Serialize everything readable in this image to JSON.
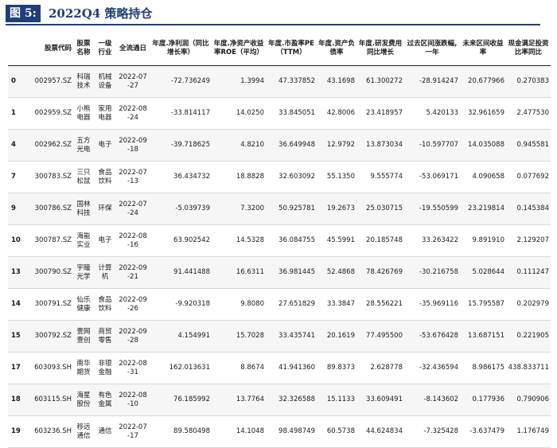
{
  "figure": {
    "label": "图 5:",
    "title": "2022Q4 策略持仓"
  },
  "table": {
    "headers": [
      "",
      "股票代码",
      "股票名称",
      "一级行业",
      "全流通日",
      "年度.净利润（同比增长率）",
      "年度.净资产收益率ROE（平均）",
      "年度.市盈率PE（TTM）",
      "年度.资产负债率",
      "年度.研发费用同比增长",
      "过去区间涨跌幅,一年",
      "未来区间收益率",
      "现金满足投资比率同比"
    ],
    "rows": [
      [
        "0",
        "002957.SZ",
        "科瑞技术",
        "机械设备",
        "2022-07-27",
        "-72.736249",
        "1.3994",
        "47.337852",
        "43.1698",
        "61.300272",
        "-28.914247",
        "20.677966",
        "0.270383"
      ],
      [
        "1",
        "002959.SZ",
        "小熊电器",
        "家用电器",
        "2022-08-24",
        "-33.814117",
        "14.0250",
        "33.845051",
        "42.8006",
        "23.418957",
        "5.420133",
        "32.961659",
        "2.477530"
      ],
      [
        "4",
        "002962.SZ",
        "五方光电",
        "电子",
        "2022-09-18",
        "-39.718625",
        "4.8210",
        "36.649948",
        "12.9792",
        "13.873034",
        "-10.597707",
        "14.035088",
        "0.945581"
      ],
      [
        "7",
        "300783.SZ",
        "三只松鼠",
        "食品饮料",
        "2022-07-13",
        "36.434732",
        "18.8828",
        "32.603092",
        "55.1350",
        "9.555774",
        "-53.069171",
        "4.090658",
        "0.077692"
      ],
      [
        "9",
        "300786.SZ",
        "国林科技",
        "环保",
        "2022-07-24",
        "-5.039739",
        "7.3200",
        "50.925781",
        "19.2673",
        "25.030715",
        "-19.550599",
        "23.219814",
        "0.145384"
      ],
      [
        "10",
        "300787.SZ",
        "海能实业",
        "电子",
        "2022-08-16",
        "63.902542",
        "14.5328",
        "36.084755",
        "45.5991",
        "20.185748",
        "33.263422",
        "9.891910",
        "2.129207"
      ],
      [
        "13",
        "300790.SZ",
        "宇瞳光学",
        "计算机",
        "2022-09-21",
        "91.441488",
        "16.6311",
        "36.981445",
        "52.4868",
        "78.426769",
        "-30.216758",
        "5.028644",
        "0.111247"
      ],
      [
        "14",
        "300791.SZ",
        "仙乐健康",
        "食品饮料",
        "2022-09-26",
        "-9.920318",
        "9.8080",
        "27.651829",
        "33.3847",
        "28.556221",
        "-35.969116",
        "15.795587",
        "0.202979"
      ],
      [
        "15",
        "300792.SZ",
        "壹网壹创",
        "商贸零售",
        "2022-09-28",
        "4.154991",
        "15.7028",
        "33.435741",
        "20.1619",
        "77.495500",
        "-53.676428",
        "13.687151",
        "0.221905"
      ],
      [
        "17",
        "603093.SH",
        "南华期货",
        "非银金融",
        "2022-08-31",
        "162.013631",
        "8.8674",
        "41.941360",
        "89.8373",
        "2.628778",
        "-32.436594",
        "8.986175",
        "438.833711"
      ],
      [
        "18",
        "603115.SH",
        "海星股份",
        "有色金属",
        "2022-08-10",
        "76.185992",
        "13.7764",
        "32.326588",
        "15.1133",
        "33.609491",
        "-8.143602",
        "0.177936",
        "0.790906"
      ],
      [
        "19",
        "603236.SH",
        "移远通信",
        "通信",
        "2022-07-17",
        "89.580498",
        "14.1048",
        "98.498749",
        "60.5738",
        "44.624834",
        "-7.325428",
        "-3.637479",
        "1.176749"
      ]
    ]
  }
}
